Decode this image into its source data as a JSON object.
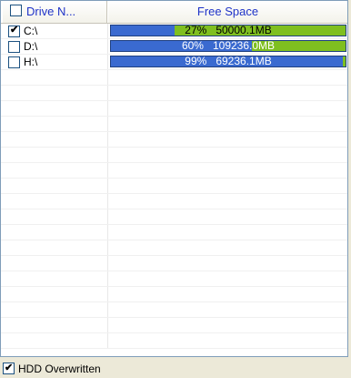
{
  "table": {
    "headers": {
      "name": "Drive N...",
      "free_space": "Free Space"
    },
    "rows": [
      {
        "drive": "C:\\",
        "checked": true,
        "used_percent": 27,
        "percent_label": "27%",
        "size_label": "50000.1MB"
      },
      {
        "drive": "D:\\",
        "checked": false,
        "used_percent": 60,
        "percent_label": "60%",
        "size_label": "109236.0MB"
      },
      {
        "drive": "H:\\",
        "checked": false,
        "used_percent": 99,
        "percent_label": "99%",
        "size_label": "69236.1MB"
      }
    ],
    "empty_row_count": 18
  },
  "footer": {
    "hdd_overwritten_label": "HDD Overwritten",
    "hdd_overwritten_checked": true
  },
  "colors": {
    "used": "#3a6ad0",
    "free": "#7fbf1f",
    "header_text": "#1f33c8"
  }
}
